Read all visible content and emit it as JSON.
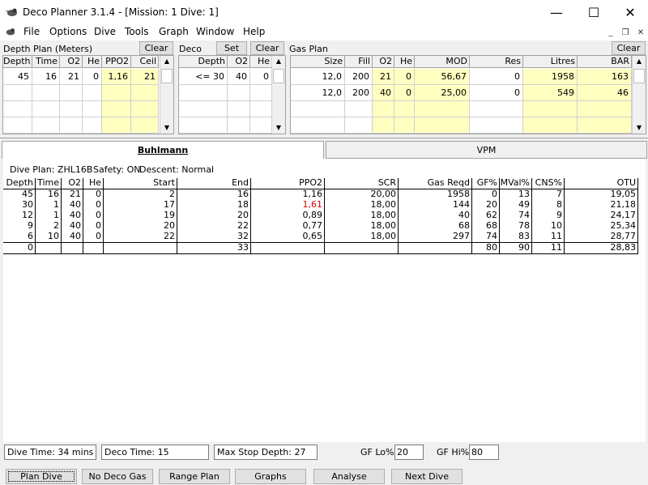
{
  "window": {
    "title": "Deco Planner 3.1.4 - [Mission: 1 Dive: 1]"
  },
  "menu": [
    "File",
    "Options",
    "Dive",
    "Tools",
    "Graph",
    "Window",
    "Help"
  ],
  "depth_plan": {
    "title": "Depth Plan (Meters)",
    "clear_label": "Clear",
    "columns": [
      "Depth",
      "Time",
      "O2",
      "He",
      "PPO2",
      "Ceil"
    ],
    "rows": [
      [
        "45",
        "16",
        "21",
        "0",
        "1,16",
        "21"
      ]
    ]
  },
  "deco": {
    "title": "Deco",
    "set_label": "Set",
    "clear_label": "Clear",
    "columns": [
      "Depth",
      "O2",
      "He"
    ],
    "rows": [
      [
        "<= 30",
        "40",
        "0"
      ]
    ]
  },
  "gas_plan": {
    "title": "Gas Plan",
    "clear_label": "Clear",
    "columns": [
      "Size",
      "Fill",
      "O2",
      "He",
      "MOD",
      "Res",
      "Litres",
      "BAR"
    ],
    "rows": [
      [
        "12,0",
        "200",
        "21",
        "0",
        "56,67",
        "0",
        "1958",
        "163"
      ],
      [
        "12,0",
        "200",
        "40",
        "0",
        "25,00",
        "0",
        "549",
        "46"
      ]
    ]
  },
  "tabs": [
    "Buhlmann",
    "VPM"
  ],
  "results": {
    "summary": {
      "plan": "Dive Plan: ZHL16B",
      "safety": "Safety: ON",
      "descent": "Descent: Normal"
    },
    "columns": [
      "Depth",
      "Time",
      "O2",
      "He",
      "Start",
      "End",
      "PPO2",
      "SCR",
      "Gas Reqd",
      "GF%",
      "MVal%",
      "CNS%",
      "OTU"
    ],
    "rows": [
      [
        "45",
        "16",
        "21",
        "0",
        "2",
        "16",
        "1,16",
        "20,00",
        "1958",
        "0",
        "13",
        "7",
        "19,05"
      ],
      [
        "30",
        "1",
        "40",
        "0",
        "17",
        "18",
        "1,61",
        "18,00",
        "144",
        "20",
        "49",
        "8",
        "21,18"
      ],
      [
        "12",
        "1",
        "40",
        "0",
        "19",
        "20",
        "0,89",
        "18,00",
        "40",
        "62",
        "74",
        "9",
        "24,17"
      ],
      [
        "9",
        "2",
        "40",
        "0",
        "20",
        "22",
        "0,77",
        "18,00",
        "68",
        "68",
        "78",
        "10",
        "25,34"
      ],
      [
        "6",
        "10",
        "40",
        "0",
        "22",
        "32",
        "0,65",
        "18,00",
        "297",
        "74",
        "83",
        "11",
        "28,77"
      ]
    ],
    "total_row": [
      "0",
      "",
      "",
      "",
      "",
      "33",
      "",
      "",
      "",
      "80",
      "90",
      "11",
      "28,83"
    ],
    "warning_color": "#d00000"
  },
  "status": {
    "dive_time": "Dive Time: 34 mins",
    "deco_time": "Deco Time: 15",
    "max_stop_depth": "Max Stop Depth: 27",
    "gf_lo_label": "GF Lo%:",
    "gf_lo_value": "20",
    "gf_hi_label": "GF Hi%:",
    "gf_hi_value": "80"
  },
  "buttons": [
    "Plan Dive",
    "No Deco Gas",
    "Range Plan",
    "Graphs",
    "Analyse",
    "Next Dive"
  ],
  "colors": {
    "highlight_cell": "#ffffc0",
    "window_bg": "#f0f0f0"
  }
}
